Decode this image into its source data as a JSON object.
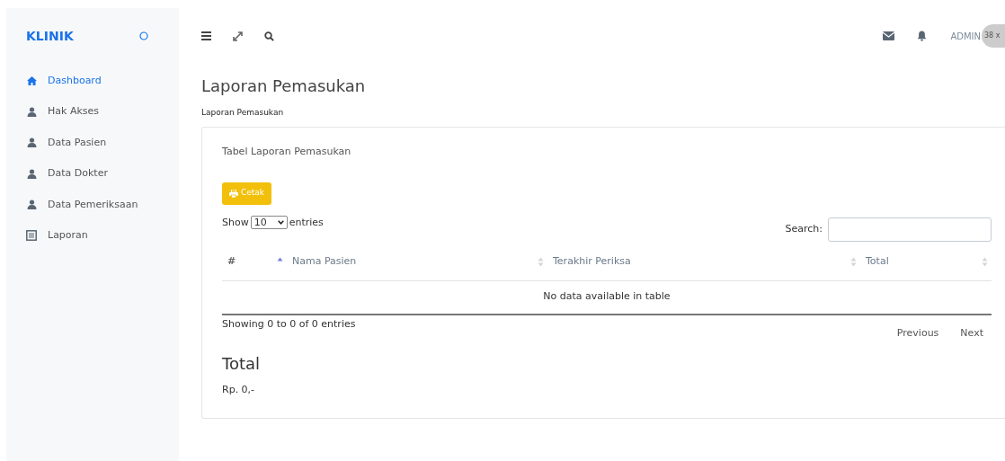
{
  "sidebar": {
    "brand": "KLINIK",
    "items": [
      {
        "label": "Dashboard",
        "kind": "home",
        "selected": true
      },
      {
        "label": "Hak Akses",
        "kind": "user",
        "selected": false
      },
      {
        "label": "Data Pasien",
        "kind": "user",
        "selected": false
      },
      {
        "label": "Data Dokter",
        "kind": "user",
        "selected": false
      },
      {
        "label": "Data Pemeriksaan",
        "kind": "user",
        "selected": false
      },
      {
        "label": "Laporan",
        "kind": "report",
        "selected": false
      }
    ]
  },
  "topbar": {
    "user": "ADMIN",
    "avatar_text": "38 x"
  },
  "page": {
    "title": "Laporan Pemasukan",
    "breadcrumb": "Laporan Pemasukan"
  },
  "card": {
    "title": "Tabel Laporan Pemasukan",
    "print_button": "Cetak",
    "length": {
      "before": "Show",
      "value": "10",
      "after": "entries"
    },
    "search_label": "Search:",
    "table": {
      "columns": [
        {
          "label": "#",
          "sorted": true
        },
        {
          "label": "Nama Pasien",
          "sorted": false
        },
        {
          "label": "Terakhir Periksa",
          "sorted": false
        },
        {
          "label": "Total",
          "sorted": false
        }
      ],
      "empty": "No data available in table"
    },
    "info": "Showing 0 to 0 of 0 entries",
    "pagination": [
      "Previous",
      "Next"
    ],
    "total_heading": "Total",
    "total_value": "Rp. 0,-"
  }
}
